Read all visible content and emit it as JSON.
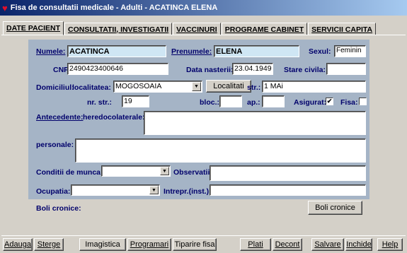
{
  "window": {
    "title": "Fisa de consultatii medicale - Adulti - ACATINCA ELENA",
    "icon": "heart-icon"
  },
  "tabs": [
    "DATE PACIENT",
    "CONSULTATII, INVESTIGATII",
    "VACCINURI",
    "PROGRAME CABINET",
    "SERVICII CAPITA"
  ],
  "form": {
    "numele_label": "Numele:",
    "numele": "ACATINCA",
    "prenumele_label": "Prenumele:",
    "prenumele": "ELENA",
    "sexul_label": "Sexul:",
    "sexul": "Feminin",
    "cnp_label": "CNP",
    "cnp": "2490423400646",
    "data_nasterii_label": "Data nasterii:",
    "data_nasterii": "23.04.1949",
    "stare_civila_label": "Stare civila:",
    "stare_civila": "",
    "domiciliul_label": "Domiciliul:",
    "localitatea_label": "localitatea:",
    "localitatea": "MOGOSOAIA",
    "localitati_button": "Localitati",
    "str_label": "str.:",
    "str": "1 MAi",
    "nr_str_label": "nr. str.:",
    "nr_str": "19",
    "bloc_label": "bloc.:",
    "bloc": "",
    "ap_label": "ap.:",
    "ap": "",
    "asigurat_label": "Asigurat:",
    "asigurat": "✔",
    "fisa_label": "Fisa:",
    "antecedente_label": "Antecedente:",
    "heredocolaterale_label": "heredocolaterale:",
    "personale_label": "personale:",
    "conditii_label": "Conditii de munca:",
    "conditii": "",
    "observatii_label": "Observatii:",
    "ocupatia_label": "Ocupatia:",
    "ocupatia": "",
    "intrepr_label": "Intrepr.(inst.):"
  },
  "boli": {
    "label": "Boli cronice:",
    "button": "Boli cronice"
  },
  "toolbar": {
    "adauga": "Adauga",
    "sterge": "Sterge",
    "imagistica": "Imagistica",
    "programari": "Programari",
    "tiparire": "Tiparire fisa",
    "plati": "Plati",
    "decont": "Decont",
    "salvare": "Salvare",
    "inchide": "Inchide",
    "help": "Help"
  },
  "colors": {
    "panel": "#a5b4c6",
    "name_field": "#cfe6f4",
    "title_bar": "#0a246a"
  }
}
